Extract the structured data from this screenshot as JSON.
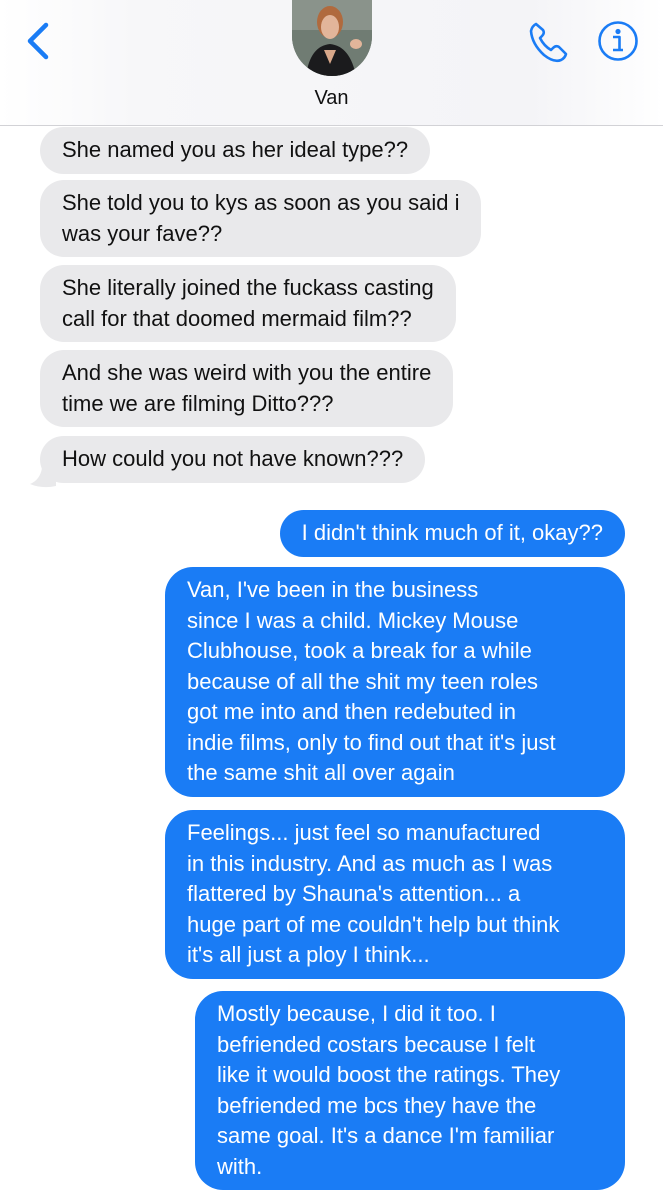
{
  "header": {
    "contact_name": "Van",
    "icons": {
      "back": "chevron-left-icon",
      "phone": "phone-icon",
      "info": "info-icon"
    },
    "accent_color": "#1a7cf5"
  },
  "messages": [
    {
      "side": "incoming",
      "text": "She named you as her ideal type??"
    },
    {
      "side": "incoming",
      "text": "She told you to kys as soon as you said i\nwas your fave??"
    },
    {
      "side": "incoming",
      "text": "She literally joined the fuckass casting\ncall for that doomed mermaid film??"
    },
    {
      "side": "incoming",
      "text": "And she was weird with you the entire\ntime we are filming Ditto???"
    },
    {
      "side": "incoming",
      "text": "How could you not have known???"
    },
    {
      "side": "outgoing",
      "text": "I didn't think much of it, okay??"
    },
    {
      "side": "outgoing",
      "text": "Van, I've been in the business\nsince I was a child. Mickey Mouse\nClubhouse, took a break for a while\nbecause of all the shit my teen roles\ngot me into  and then redebuted in\nindie films, only to find out that it's just\nthe same shit all over again"
    },
    {
      "side": "outgoing",
      "text": "Feelings... just feel so manufactured\nin this industry. And as much as I was\nflattered by Shauna's attention... a\nhuge part of me couldn't help but think\nit's all just a ploy I think..."
    },
    {
      "side": "outgoing",
      "text": "Mostly because, I did it too. I\nbefriended costars because I felt\nlike it would boost the ratings. They\nbefriended me bcs they have the\nsame goal. It's a dance I'm familiar\nwith."
    }
  ]
}
